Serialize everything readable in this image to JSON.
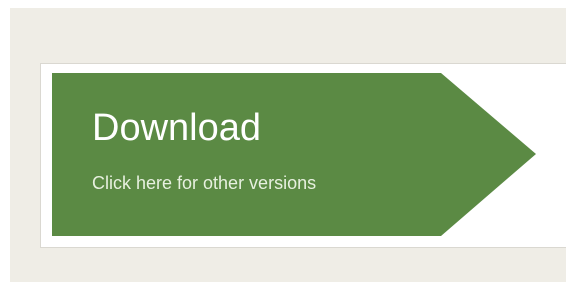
{
  "download_button": {
    "title": "Download",
    "subtitle": "Click here for other versions",
    "accent_color": "#5b8a44"
  },
  "colors": {
    "page_background": "#efede6",
    "card_background": "#ffffff",
    "card_border": "#dad8d1",
    "text_primary": "#ffffff"
  }
}
